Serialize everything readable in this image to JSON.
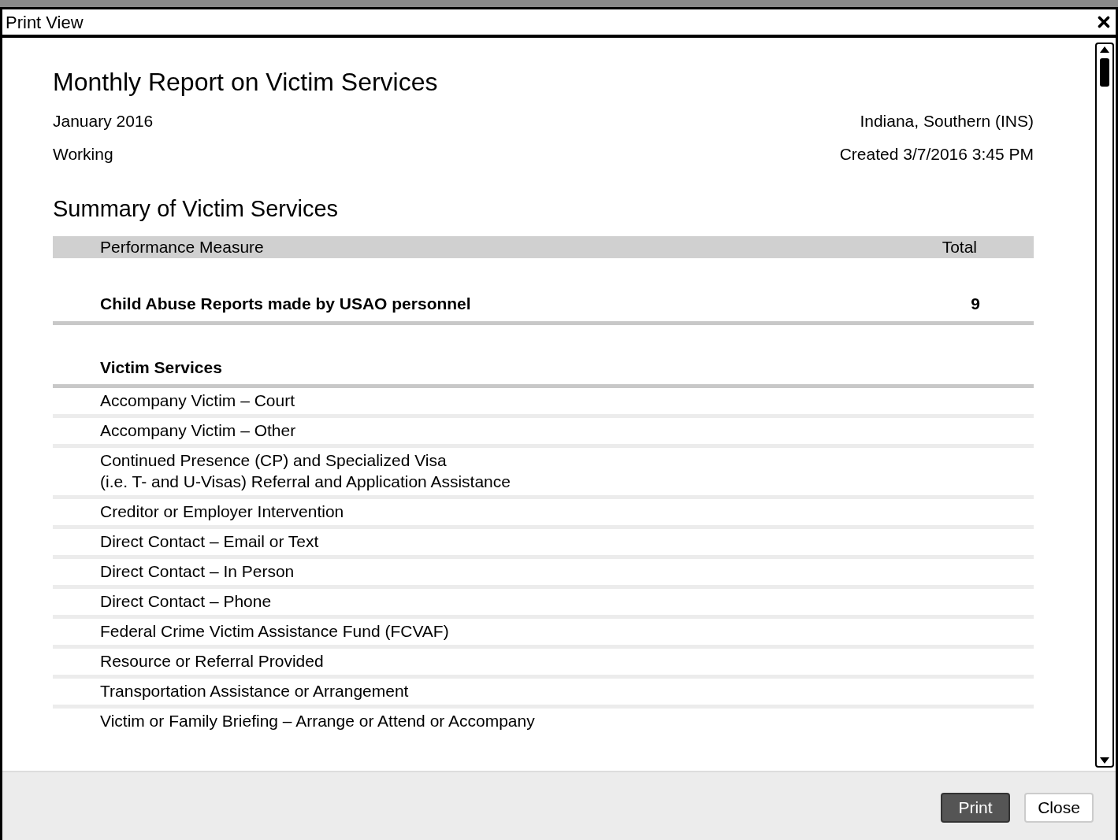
{
  "window": {
    "title": "Print View"
  },
  "report": {
    "title": "Monthly Report on Victim Services",
    "period": "January 2016",
    "status": "Working",
    "district": "Indiana, Southern (INS)",
    "created": "Created 3/7/2016 3:45 PM"
  },
  "summary": {
    "title": "Summary of Victim Services",
    "columns": [
      "Performance Measure",
      "Total"
    ],
    "highlight": {
      "label": "Child Abuse Reports made by USAO personnel",
      "total": "9"
    },
    "group": "Victim Services",
    "items": [
      "Accompany Victim – Court",
      "Accompany Victim – Other",
      "Continued Presence (CP) and Specialized Visa\n(i.e. T- and U-Visas) Referral and Application Assistance",
      "Creditor or Employer Intervention",
      "Direct Contact – Email or Text",
      "Direct Contact – In Person",
      "Direct Contact – Phone",
      "Federal Crime Victim Assistance Fund (FCVAF)",
      "Resource or Referral Provided",
      "Transportation Assistance or Arrangement",
      "Victim or Family Briefing – Arrange or Attend or Accompany"
    ]
  },
  "buttons": [
    {
      "label": "Print",
      "kind": "primary"
    },
    {
      "label": "Close",
      "kind": "secondary"
    }
  ]
}
